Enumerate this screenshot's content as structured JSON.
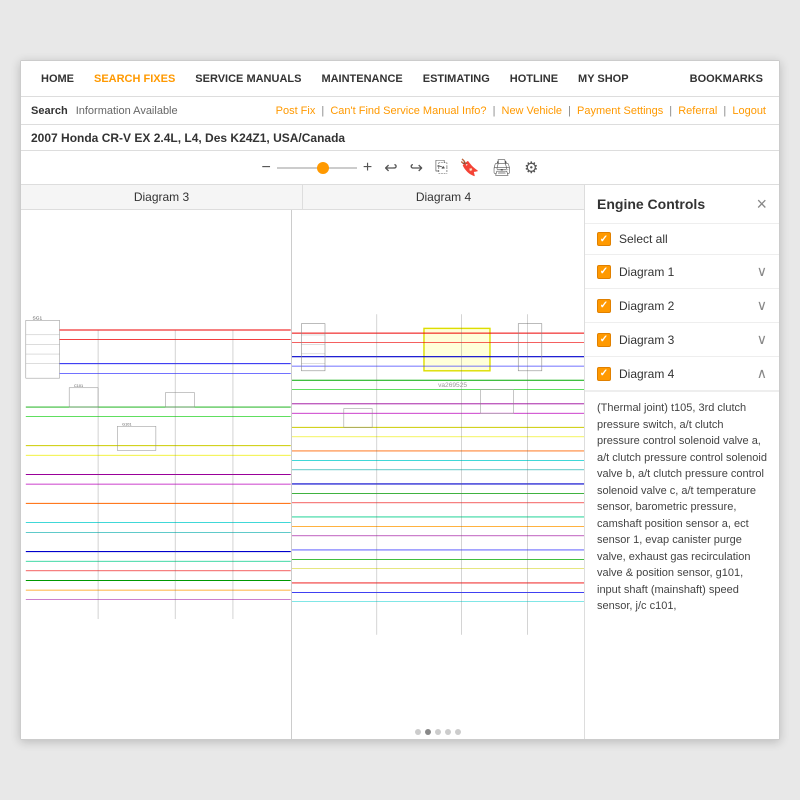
{
  "nav": {
    "items": [
      {
        "id": "home",
        "label": "HOME",
        "active": false
      },
      {
        "id": "search-fixes",
        "label": "SEARCH FIXES",
        "active": true
      },
      {
        "id": "service-manuals",
        "label": "SERVICE MANUALS",
        "active": false
      },
      {
        "id": "maintenance",
        "label": "MAINTENANCE",
        "active": false
      },
      {
        "id": "estimating",
        "label": "ESTIMATING",
        "active": false
      },
      {
        "id": "hotline",
        "label": "HOTLINE",
        "active": false
      },
      {
        "id": "my-shop",
        "label": "MY SHOP",
        "active": false
      }
    ],
    "bookmarks": "BOOKMARKS"
  },
  "search_bar": {
    "label": "Search",
    "status": "Information Available",
    "links": [
      "Post Fix",
      "Can't Find Service Manual Info?",
      "New Vehicle",
      "Payment Settings",
      "Referral",
      "Logout"
    ]
  },
  "vehicle": {
    "text": "2007 Honda CR-V EX 2.4L, L4, Des K24Z1, USA/Canada"
  },
  "toolbar": {
    "icons": [
      "−",
      "+",
      "⟲",
      "⟳",
      "⎘",
      "🔖",
      "🖨",
      "⚙"
    ]
  },
  "diagrams": {
    "headers": [
      "Diagram 3",
      "Diagram 4"
    ],
    "watermark": "va269525"
  },
  "engine_controls": {
    "title": "Engine Controls",
    "close_label": "×",
    "select_all": "Select all",
    "items": [
      {
        "label": "Diagram 1",
        "expanded": false,
        "checked": true
      },
      {
        "label": "Diagram 2",
        "expanded": false,
        "checked": true
      },
      {
        "label": "Diagram 3",
        "expanded": false,
        "checked": true
      },
      {
        "label": "Diagram 4",
        "expanded": true,
        "checked": true
      }
    ],
    "description": "(Thermal joint) t105, 3rd clutch pressure switch, a/t clutch pressure control solenoid valve a, a/t clutch pressure control solenoid valve b, a/t clutch pressure control solenoid valve c, a/t temperature sensor, barometric pressure, camshaft position sensor a, ect sensor 1, evap canister purge valve, exhaust gas recirculation valve & position sensor, g101, input shaft (mainshaft) speed sensor, j/c c101,"
  }
}
